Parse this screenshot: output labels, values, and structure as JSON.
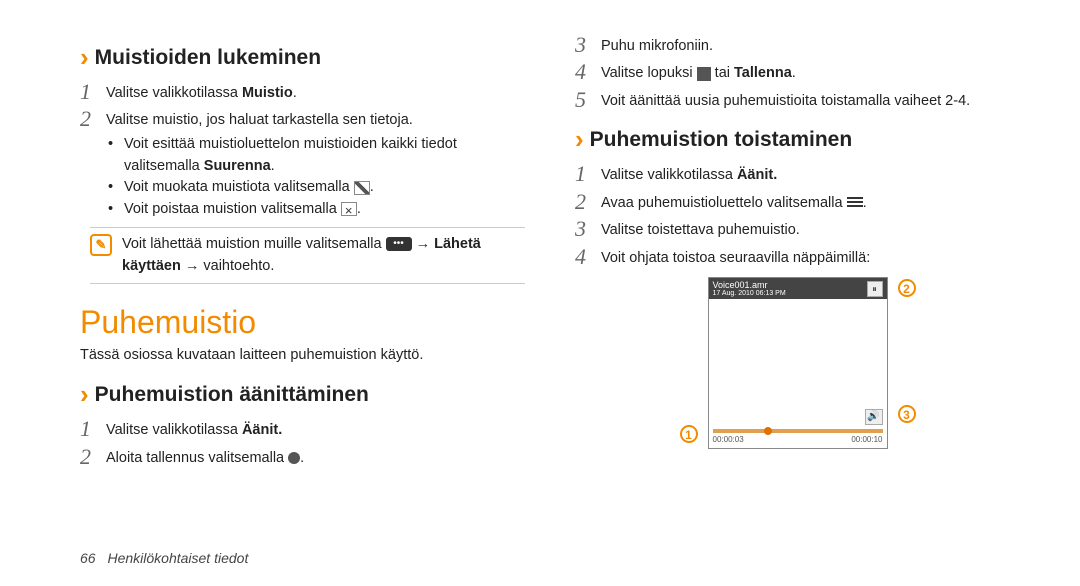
{
  "left": {
    "s1_title": "Muistioiden lukeminen",
    "s1_step1": "Valitse valikkotilassa <b>Muistio</b>.",
    "s1_step2": "Valitse muistio, jos haluat tarkastella sen tietoja.",
    "s1_b1": "Voit esittää muistioluettelon muistioiden kaikki tiedot valitsemalla <b>Suurenna</b>.",
    "s1_b2_pre": "Voit muokata muistiota valitsemalla ",
    "s1_b2_post": ".",
    "s1_b3_pre": "Voit poistaa muistion valitsemalla ",
    "s1_b3_post": ".",
    "note_pre": "Voit lähettää muistion muille valitsemalla ",
    "note_post": " → <b>Lähetä käyttäen</b> → vaihtoehto.",
    "big_title": "Puhemuistio",
    "intro": "Tässä osiossa kuvataan laitteen puhemuistion käyttö.",
    "s2_title": "Puhemuistion äänittäminen",
    "s2_step1": "Valitse valikkotilassa <b>Äänit.</b>",
    "s2_step2_pre": "Aloita tallennus valitsemalla ",
    "s2_step2_post": "."
  },
  "right": {
    "step3": "Puhu mikrofoniin.",
    "step4_pre": "Valitse lopuksi ",
    "step4_post": " tai <b>Tallenna</b>.",
    "step5": "Voit äänittää uusia puhemuistioita toistamalla vaiheet 2-4.",
    "s3_title": "Puhemuistion toistaminen",
    "s3_step1": "Valitse valikkotilassa <b>Äänit.</b>",
    "s3_step2_pre": "Avaa puhemuistioluettelo valitsemalla ",
    "s3_step2_post": ".",
    "s3_step3": "Valitse toistettava puhemuistio.",
    "s3_step4": "Voit ohjata toistoa seuraavilla näppäimillä:"
  },
  "player": {
    "file": "Voice001.amr",
    "date": "17 Aug. 2010 06:13 PM",
    "t_cur": "00:00:03",
    "t_end": "00:00:10",
    "callouts": {
      "c1": "1",
      "c2": "2",
      "c3": "3"
    }
  },
  "footer": {
    "page": "66",
    "section": "Henkilökohtaiset tiedot"
  }
}
